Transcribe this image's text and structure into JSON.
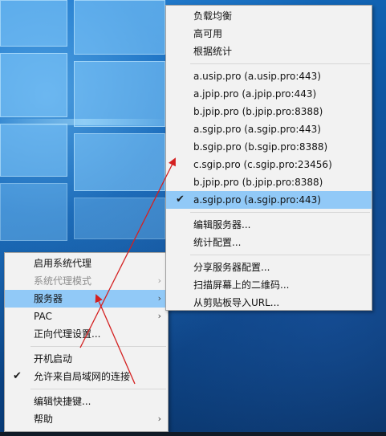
{
  "main_menu": {
    "items": [
      {
        "label": "启用系统代理",
        "type": "item"
      },
      {
        "label": "系统代理模式",
        "type": "submenu",
        "disabled": true
      },
      {
        "label": "服务器",
        "type": "submenu",
        "highlighted": true
      },
      {
        "label": "PAC",
        "type": "submenu"
      },
      {
        "label": "正向代理设置...",
        "type": "item"
      },
      {
        "label": "开机启动",
        "type": "item"
      },
      {
        "label": "允许来自局域网的连接",
        "type": "item",
        "checked": true
      },
      {
        "label": "编辑快捷键...",
        "type": "item"
      },
      {
        "label": "帮助",
        "type": "submenu"
      }
    ]
  },
  "server_submenu": {
    "balance": [
      "负载均衡",
      "高可用",
      "根据统计"
    ],
    "servers": [
      "a.usip.pro (a.usip.pro:443)",
      "a.jpip.pro (a.jpip.pro:443)",
      "b.jpip.pro (b.jpip.pro:8388)",
      "a.sgip.pro (a.sgip.pro:443)",
      "b.sgip.pro (b.sgip.pro:8388)",
      "c.sgip.pro (c.sgip.pro:23456)",
      "b.jpip.pro (b.jpip.pro:8388)",
      "a.sgip.pro (a.sgip.pro:443)"
    ],
    "selected_index": 7,
    "edit": [
      "编辑服务器...",
      "统计配置..."
    ],
    "import": [
      "分享服务器配置...",
      "扫描屏幕上的二维码...",
      "从剪贴板导入URL..."
    ]
  },
  "glyphs": {
    "submenu_arrow": "›",
    "check": "✔"
  },
  "colors": {
    "highlight": "#91c9f7",
    "annotation_arrow": "#d42020",
    "menu_bg": "#f2f2f2"
  }
}
